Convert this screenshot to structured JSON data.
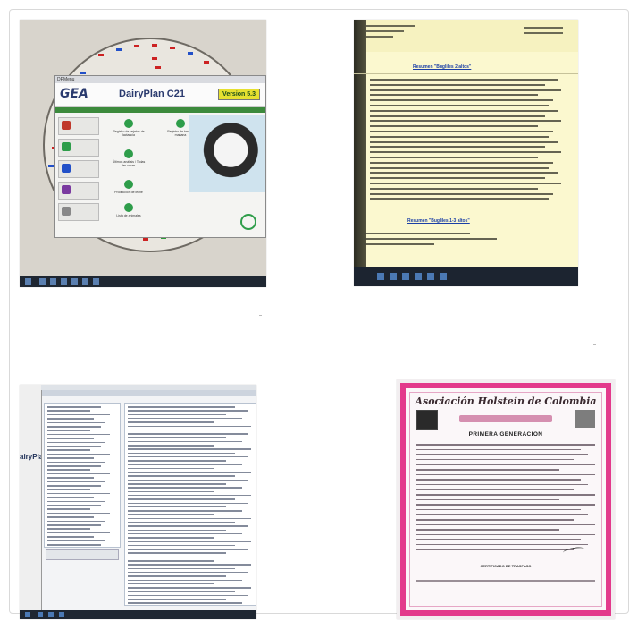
{
  "photo1": {
    "window_title": "DPMenu",
    "brand": "GEA",
    "app_name": "DairyPlan C21",
    "version": "Version 5.3",
    "items": [
      {
        "label": "Registro de tarjetas de lactancia"
      },
      {
        "label": "Registro de tarde y mañana"
      },
      {
        "label": "Últimos análisis / Todas las vacas"
      },
      {
        "label": "Producción de leche"
      },
      {
        "label": "Lista de animales"
      }
    ]
  },
  "photo2": {
    "title_1": "Resumen \"Bugliles 2 altos\"",
    "title_2": "Resumen \"Bugliles 1-3 altos\""
  },
  "photo3": {
    "side_label": "airyPla"
  },
  "photo4": {
    "org_title": "Asociación Holstein de Colombia",
    "heading": "PRIMERA GENERACION",
    "certificate_label": "CERTIFICADO DE TRASPASO"
  }
}
